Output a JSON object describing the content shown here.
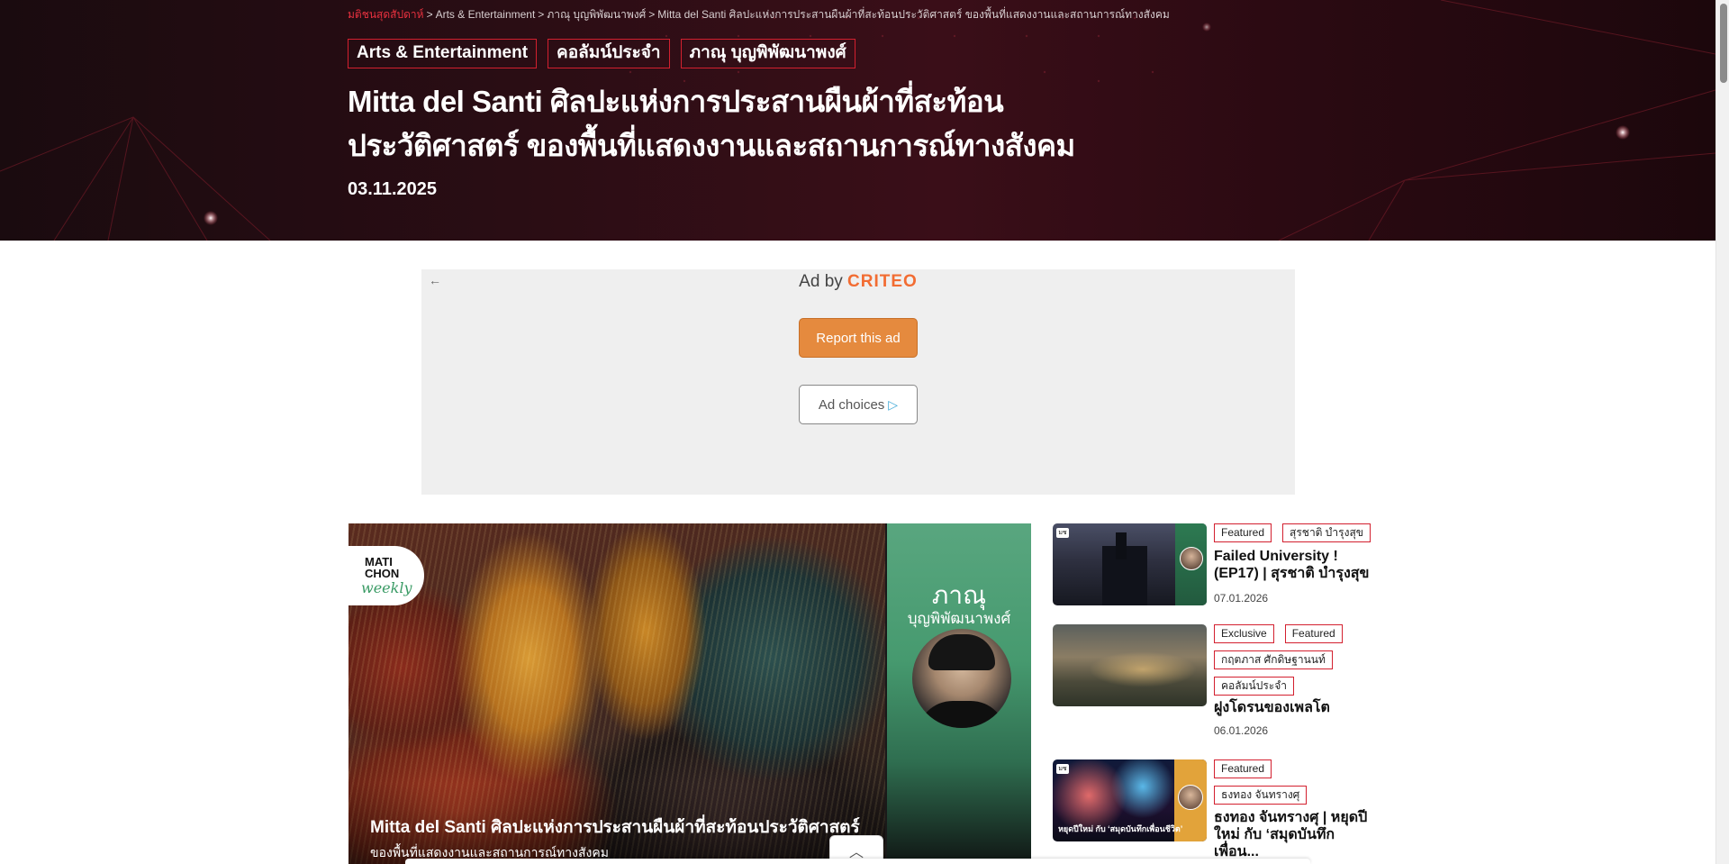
{
  "hero": {
    "breadcrumb": {
      "home": "มติชนสุดสัปดาห์",
      "separator": ">",
      "level1": "Arts & Entertainment",
      "level2": "ภาณุ บุญพิพัฒนาพงศ์",
      "current": "Mitta del Santi ศิลปะแห่งการประสานผืนผ้าที่สะท้อนประวัติศาสตร์ ของพื้นที่แสดงงานและสถานการณ์ทางสังคม"
    },
    "tags": [
      "Arts & Entertainment",
      "คอลัมน์ประจำ",
      "ภาณุ บุญพิพัฒนาพงศ์"
    ],
    "title_line1": "Mitta del Santi ศิลปะแห่งการประสานผืนผ้าที่สะท้อน",
    "title_line2": "ประวัติศาสตร์ ของพื้นที่แสดงงานและสถานการณ์ทางสังคม",
    "date": "03.11.2025"
  },
  "ad": {
    "back_icon": "←",
    "ad_by": "Ad by",
    "brand": "CRITEO",
    "report_label": "Report this ad",
    "choices_label": "Ad choices",
    "choices_icon": "▷"
  },
  "main_image": {
    "logo_line1": "MATI",
    "logo_line2": "CHON",
    "logo_line3": "weekly",
    "author_name": "ภาณุ",
    "author_surname": "บุญพิพัฒนาพงศ์",
    "caption_line1": "Mitta del Santi  ศิลปะแห่งการประสานผืนผ้าที่สะท้อนประวัติศาสตร์",
    "caption_line2": "ของพื้นที่แสดงงานและสถานการณ์ทางสังคม",
    "scroll_up_icon": "︿"
  },
  "sidebar": {
    "items": [
      {
        "badge": "มช",
        "tags": [
          "Featured",
          "สุรชาติ บำรุงสุข"
        ],
        "title": "Failed University ! (EP17) | สุรชาติ บำรุงสุข",
        "date": "07.01.2026"
      },
      {
        "tags": [
          "Exclusive",
          "Featured",
          "กฤตภาส ศักดิษฐานนท์",
          "คอลัมน์ประจำ"
        ],
        "title": "ฝูงโดรนของเพลโต",
        "date": "06.01.2026"
      },
      {
        "badge": "มช",
        "thumb_caption": "หยุดปีใหม่ กับ ‘สมุดบันทึกเพื่อนชีวิต’",
        "tags": [
          "Featured",
          "ธงทอง จันทรางศุ"
        ],
        "title": "ธงทอง จันทรางศุ | หยุดปีใหม่ กับ ‘สมุดบันทึกเพื่อน...",
        "date": ""
      }
    ]
  }
}
